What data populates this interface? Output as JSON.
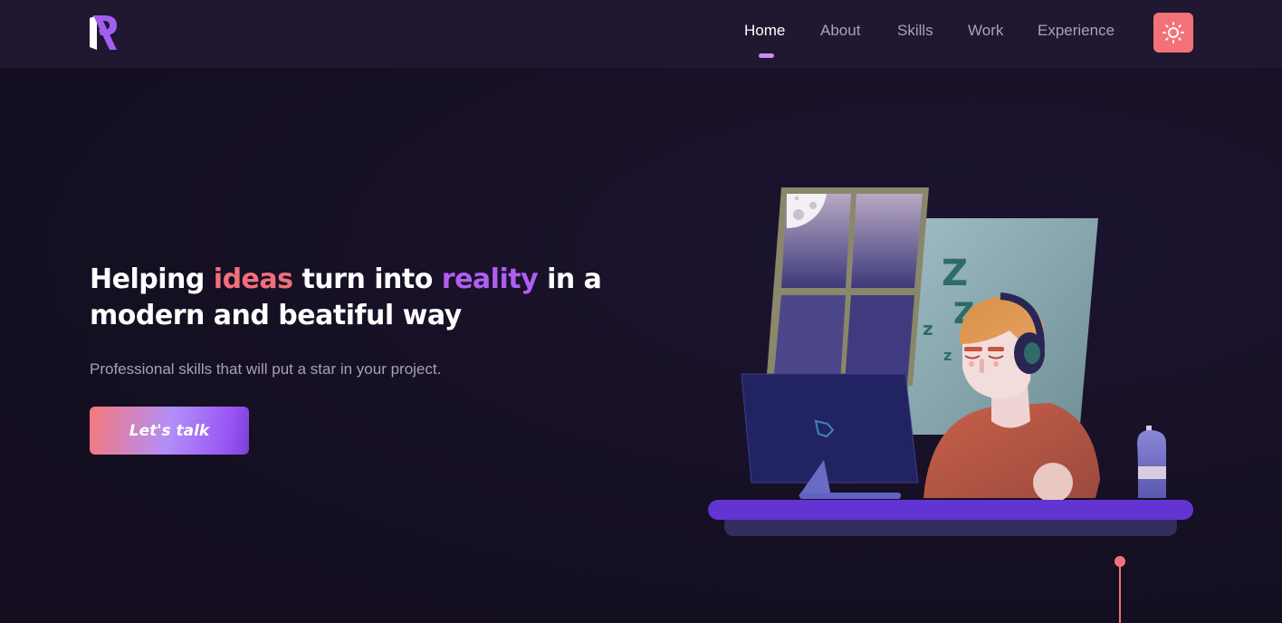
{
  "nav": {
    "logo_icon": "r-logo-icon",
    "links": [
      {
        "label": "Home",
        "active": true
      },
      {
        "label": "About",
        "active": false
      },
      {
        "label": "Skills",
        "active": false
      },
      {
        "label": "Work",
        "active": false
      },
      {
        "label": "Experience",
        "active": false
      }
    ],
    "theme_toggle_icon": "sun-icon"
  },
  "hero": {
    "title_part1": "Helping ",
    "title_highlight1": "ideas",
    "title_part2": " turn into ",
    "title_highlight2": "reality",
    "title_part3": " in a modern and beatiful way",
    "subtitle": "Professional skills that will put a star in your project.",
    "cta_label": "Let's talk"
  },
  "illustration": {
    "description_icon": "sleeping-developer-illustration",
    "sleep_letters": [
      "Z",
      "Z",
      "z",
      "z"
    ]
  },
  "colors": {
    "background": "#160f24",
    "navbar": "#1f1830",
    "accent_pink": "#f26f7a",
    "accent_purple": "#b05ef0",
    "indicator": "#c48ef2",
    "toggle": "#f37277"
  }
}
